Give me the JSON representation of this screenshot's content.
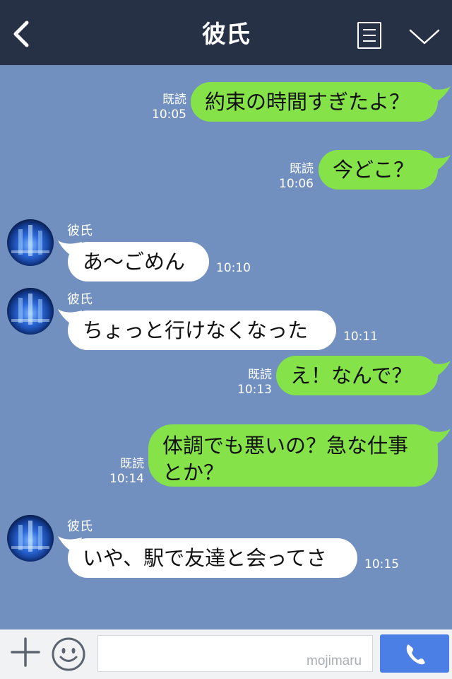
{
  "header": {
    "title": "彼氏"
  },
  "messages": [
    {
      "side": "me",
      "text": "約束の時間すぎたよ？",
      "read": "既読",
      "time": "10:05"
    },
    {
      "side": "me",
      "text": "今どこ？",
      "read": "既読",
      "time": "10:06"
    },
    {
      "side": "them",
      "sender": "彼氏",
      "text": "あ〜ごめん",
      "time": "10:10"
    },
    {
      "side": "them",
      "sender": "彼氏",
      "text": "ちょっと行けなくなった",
      "time": "10:11"
    },
    {
      "side": "me",
      "text": "え！なんで？",
      "read": "既読",
      "time": "10:13"
    },
    {
      "side": "me",
      "text": "体調でも悪いの？急な仕事とか？",
      "read": "既読",
      "time": "10:14"
    },
    {
      "side": "them",
      "sender": "彼氏",
      "text": "いや、駅で友達と会ってさ",
      "time": "10:15"
    }
  ],
  "input": {
    "value": "",
    "watermark": "mojimaru"
  },
  "icons": {
    "back": "chevron-left-icon",
    "menu": "menu-icon",
    "collapse": "chevron-down-icon",
    "add": "plus-icon",
    "emoji": "smile-icon",
    "call": "phone-icon"
  },
  "colors": {
    "header": "#263146",
    "chat_background": "#7190c0",
    "my_bubble": "#85e249",
    "their_bubble": "#ffffff",
    "call_button": "#4b7fe6"
  }
}
